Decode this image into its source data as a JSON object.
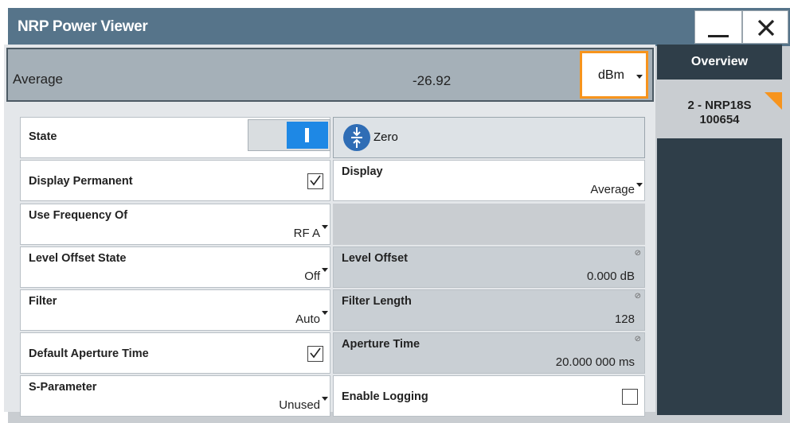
{
  "window": {
    "title": "NRP Power Viewer"
  },
  "measurement": {
    "label": "Average",
    "value": "-26.92",
    "unit": "dBm"
  },
  "sidebar": {
    "tabs": [
      {
        "label": "Overview"
      },
      {
        "line1": "2 - NRP18S",
        "line2": "100654"
      }
    ]
  },
  "fields": {
    "state": {
      "label": "State",
      "on": true
    },
    "zero": {
      "label": "Zero"
    },
    "display_permanent": {
      "label": "Display Permanent",
      "checked": true
    },
    "display": {
      "label": "Display",
      "value": "Average"
    },
    "use_frequency_of": {
      "label": "Use Frequency Of",
      "value": "RF A"
    },
    "level_offset_state": {
      "label": "Level Offset State",
      "value": "Off"
    },
    "level_offset": {
      "label": "Level Offset",
      "value": "0.000 dB"
    },
    "filter": {
      "label": "Filter",
      "value": "Auto"
    },
    "filter_length": {
      "label": "Filter Length",
      "value": "128"
    },
    "default_aperture_time": {
      "label": "Default Aperture Time",
      "checked": true
    },
    "aperture_time": {
      "label": "Aperture Time",
      "value": "20.000 000 ms"
    },
    "s_parameter": {
      "label": "S-Parameter",
      "value": "Unused"
    },
    "enable_logging": {
      "label": "Enable Logging",
      "checked": false
    }
  },
  "colors": {
    "titlebar": "#56748a",
    "accent": "#f7941d",
    "toggle_on": "#1e88e5",
    "sidebar": "#2f3e49"
  }
}
